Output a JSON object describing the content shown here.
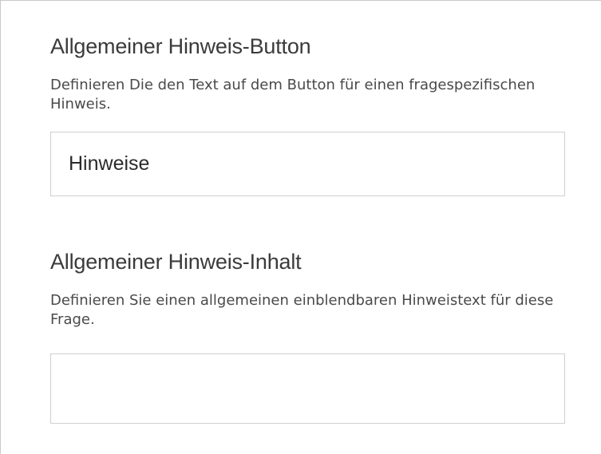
{
  "general_hint_button": {
    "title": "Allgemeiner Hinweis-Button",
    "description": "Definieren Die den Text auf dem Button für einen fragespezifischen Hinweis.",
    "input_value": "Hinweise"
  },
  "general_hint_content": {
    "title": "Allgemeiner Hinweis-Inhalt",
    "description": "Definieren Sie einen allgemeinen einblendbaren Hinweistext für diese Frage.",
    "input_value": ""
  }
}
